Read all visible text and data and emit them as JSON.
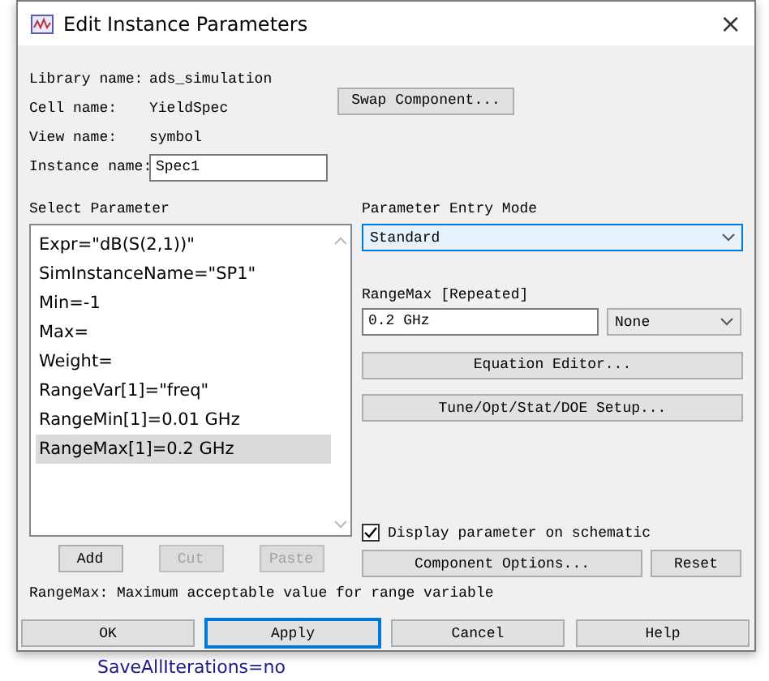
{
  "window": {
    "title": "Edit Instance Parameters",
    "close": "×"
  },
  "info": [
    {
      "label": "Library name:",
      "value": "ads_simulation"
    },
    {
      "label": "Cell name:",
      "value": "YieldSpec"
    },
    {
      "label": "View name:",
      "value": "symbol"
    }
  ],
  "instance": {
    "label": "Instance name:",
    "value": "Spec1"
  },
  "swap_button": "Swap Component...",
  "select_parameter": {
    "label": "Select Parameter",
    "items": [
      {
        "text": "Expr=\"dB(S(2,1))\"",
        "selected": false
      },
      {
        "text": "SimInstanceName=\"SP1\"",
        "selected": false
      },
      {
        "text": "Min=-1",
        "selected": false
      },
      {
        "text": "Max=",
        "selected": false
      },
      {
        "text": "Weight=",
        "selected": false
      },
      {
        "text": "RangeVar[1]=\"freq\"",
        "selected": false
      },
      {
        "text": "RangeMin[1]=0.01 GHz",
        "selected": false
      },
      {
        "text": "RangeMax[1]=0.2 GHz",
        "selected": true
      }
    ]
  },
  "list_buttons": [
    {
      "label": "Add",
      "disabled": false
    },
    {
      "label": "Cut",
      "disabled": true
    },
    {
      "label": "Paste",
      "disabled": true
    }
  ],
  "entry_mode": {
    "label": "Parameter Entry Mode",
    "value": "Standard"
  },
  "param": {
    "label": "RangeMax [Repeated]",
    "value": "0.2 GHz",
    "unit": "None"
  },
  "tool_buttons": [
    "Equation Editor...",
    "Tune/Opt/Stat/DOE Setup..."
  ],
  "display_on_schematic": {
    "label": "Display parameter on schematic",
    "checked": true
  },
  "option_buttons": [
    "Component Options...",
    "Reset"
  ],
  "description": "RangeMax: Maximum acceptable value for range variable",
  "dialog_buttons": [
    {
      "label": "OK",
      "default": false
    },
    {
      "label": "Apply",
      "default": true
    },
    {
      "label": "Cancel",
      "default": false
    },
    {
      "label": "Help",
      "default": false
    }
  ],
  "background_text": "SaveAllIterations=no"
}
